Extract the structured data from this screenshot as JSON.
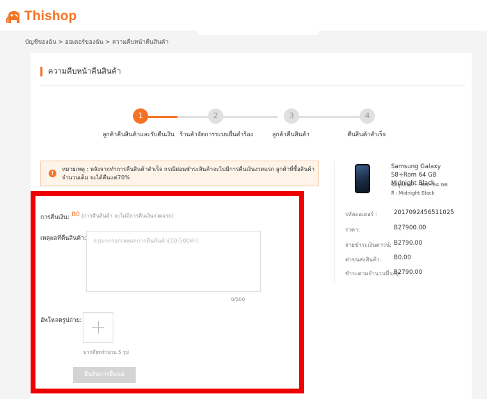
{
  "header": {
    "logo_text": "Thishop"
  },
  "breadcrumb": "บัญชีของฉัน > ออเดอร์ของฉัน > ความคืบหน้าคืนสินค้า",
  "page_title": "ความคืบหน้าคืนสินค้า",
  "steps": [
    {
      "number": "1",
      "label": "ลูกค้าคืนสินค้าและรับคืนเงิน",
      "active": true
    },
    {
      "number": "2",
      "label": "ร้านค้าจัดการระบบยื่นคำร้อง",
      "active": false
    },
    {
      "number": "3",
      "label": "ลูกค้าคืนสินค้า",
      "active": false
    },
    {
      "number": "4",
      "label": "คืนสินค้าสำเร็จ",
      "active": false
    }
  ],
  "notice": {
    "icon": "!",
    "text": "หมายเหตุ : หลังจากทำการคืนสินค้าสำเร็จ กรณีผ่อนชำระสินค้าจะไม่มีการคืนเงินงวดแรก ลูกค้าที่ซื้อสินค้าจำนวนเต็ม จะได้คืนแค่70%"
  },
  "product": {
    "name": "Samsung Galaxy S8+Rom 64 GB Midnight Black",
    "rom": "ข้อมูลสินค้า : Rom 64 GB",
    "color": "สี : Midnight Black"
  },
  "order_info": [
    {
      "label": "รหัสออเดอร์ :",
      "value": "2017092456511025"
    },
    {
      "label": "ราคา:",
      "value": "B27900.00"
    },
    {
      "label": "จ่ายชำระเงินดาวน์:",
      "value": "B2790.00"
    },
    {
      "label": "ค่าขนส่งสินค้า:",
      "value": "B0.00"
    },
    {
      "label": "ชำระตามจำนวนที่ระบุ:",
      "value": "B2790.00"
    }
  ],
  "form": {
    "refund_label": "การคืนเงิน:",
    "refund_amount": "B0",
    "refund_note": "(การคืนสินค้า จะไม่มีการคืนเงินงวดแรก)",
    "reason_label": "เหตุผลที่คืนสินค้า:",
    "reason_placeholder": "กรุณากรอกเหตุผลการคืนสินค้า(10-500คำ)",
    "char_count": "0/500",
    "upload_label": "อัพโหลดรูปถ่าย:",
    "upload_hint": "มากที่สุดจำนวน 5 รูป",
    "submit_label": "ยืนยันการยื่นขอ"
  },
  "colors": {
    "accent": "#f57224",
    "highlight": "#ee0000"
  }
}
